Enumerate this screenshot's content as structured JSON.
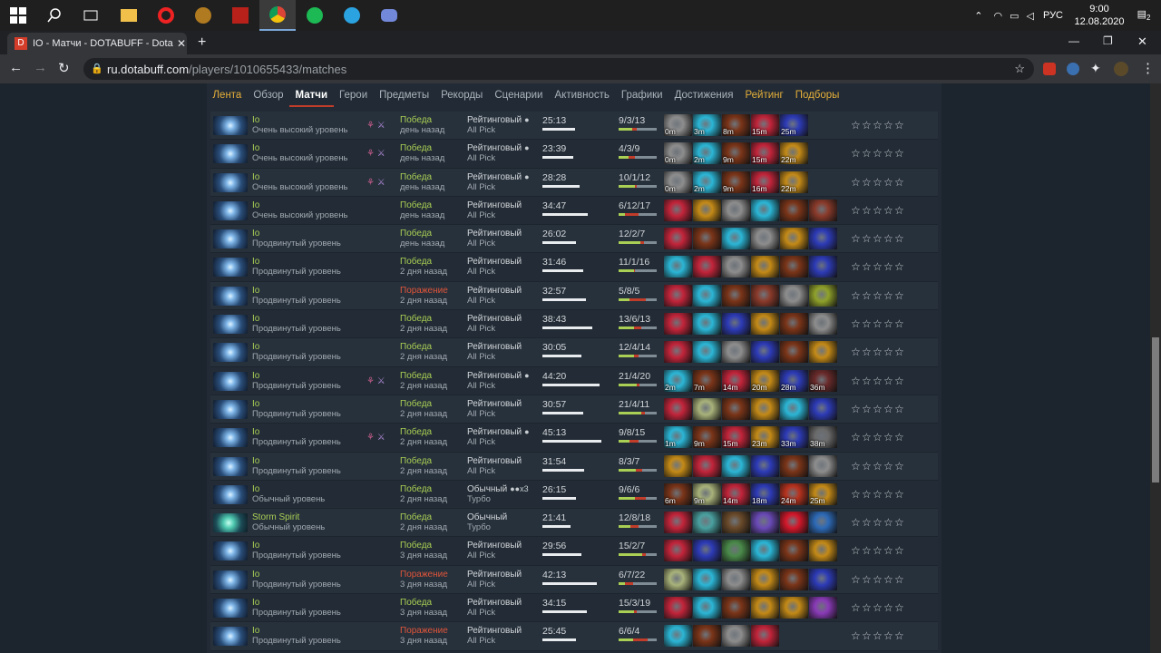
{
  "taskbar": {
    "language": "РУС",
    "time": "9:00",
    "date": "12.08.2020",
    "notifications": "2"
  },
  "browser": {
    "tab_title": "IO - Матчи - DOTABUFF - Dota 2",
    "url_host": "ru.dotabuff.com",
    "url_path": "/players/1010655433/matches"
  },
  "nav": [
    {
      "label": "Лента",
      "style": "gold"
    },
    {
      "label": "Обзор",
      "style": ""
    },
    {
      "label": "Матчи",
      "style": "active"
    },
    {
      "label": "Герои",
      "style": ""
    },
    {
      "label": "Предметы",
      "style": ""
    },
    {
      "label": "Рекорды",
      "style": ""
    },
    {
      "label": "Сценарии",
      "style": ""
    },
    {
      "label": "Активность",
      "style": ""
    },
    {
      "label": "Графики",
      "style": ""
    },
    {
      "label": "Достижения",
      "style": ""
    },
    {
      "label": "Рейтинг",
      "style": "gold"
    },
    {
      "label": "Подборы",
      "style": "gold"
    }
  ],
  "matches": [
    {
      "hero": "Io",
      "skill": "Очень высокий уровень",
      "party": true,
      "result": "Победа",
      "win": true,
      "ago": "день назад",
      "type": "Рейтинговый",
      "party_icon": "person-icon",
      "party_text": "",
      "mode": "All Pick",
      "duration": "25:13",
      "duration_fraction": 0.5,
      "kda": "9/3/13",
      "k": 9,
      "d": 3,
      "a": 13,
      "items": [
        {
          "c": "#8d8d8d",
          "t": "0m"
        },
        {
          "c": "#2bb6d6",
          "t": "3m"
        },
        {
          "c": "#7a3418",
          "t": "8m"
        },
        {
          "c": "#c2243a",
          "t": "15m"
        },
        {
          "c": "#2d3bb7",
          "t": "25m"
        }
      ]
    },
    {
      "hero": "Io",
      "skill": "Очень высокий уровень",
      "party": true,
      "result": "Победа",
      "win": true,
      "ago": "день назад",
      "type": "Рейтинговый",
      "party_icon": "person-icon",
      "party_text": "",
      "mode": "All Pick",
      "duration": "23:39",
      "duration_fraction": 0.47,
      "kda": "4/3/9",
      "k": 4,
      "d": 3,
      "a": 9,
      "items": [
        {
          "c": "#8d8d8d",
          "t": "0m"
        },
        {
          "c": "#2bb6d6",
          "t": "2m"
        },
        {
          "c": "#7a3418",
          "t": "9m"
        },
        {
          "c": "#c2243a",
          "t": "15m"
        },
        {
          "c": "#c48a17",
          "t": "22m"
        }
      ]
    },
    {
      "hero": "Io",
      "skill": "Очень высокий уровень",
      "party": true,
      "result": "Победа",
      "win": true,
      "ago": "день назад",
      "type": "Рейтинговый",
      "party_icon": "person-icon",
      "party_text": "",
      "mode": "All Pick",
      "duration": "28:28",
      "duration_fraction": 0.57,
      "kda": "10/1/12",
      "k": 10,
      "d": 1,
      "a": 12,
      "items": [
        {
          "c": "#8d8d8d",
          "t": "0m"
        },
        {
          "c": "#2bb6d6",
          "t": "2m"
        },
        {
          "c": "#7a3418",
          "t": "9m"
        },
        {
          "c": "#c2243a",
          "t": "16m"
        },
        {
          "c": "#c48a17",
          "t": "22m"
        }
      ]
    },
    {
      "hero": "Io",
      "skill": "Очень высокий уровень",
      "party": false,
      "result": "Победа",
      "win": true,
      "ago": "день назад",
      "type": "Рейтинговый",
      "party_icon": "",
      "party_text": "",
      "mode": "All Pick",
      "duration": "34:47",
      "duration_fraction": 0.7,
      "kda": "6/12/17",
      "k": 6,
      "d": 12,
      "a": 17,
      "items": [
        {
          "c": "#c2243a",
          "t": ""
        },
        {
          "c": "#c48a17",
          "t": ""
        },
        {
          "c": "#8d8d8d",
          "t": ""
        },
        {
          "c": "#2bb6d6",
          "t": ""
        },
        {
          "c": "#7a3418",
          "t": ""
        },
        {
          "c": "#8a3a2a",
          "t": ""
        }
      ]
    },
    {
      "hero": "Io",
      "skill": "Продвинутый уровень",
      "party": false,
      "result": "Победа",
      "win": true,
      "ago": "день назад",
      "type": "Рейтинговый",
      "party_icon": "",
      "party_text": "",
      "mode": "All Pick",
      "duration": "26:02",
      "duration_fraction": 0.52,
      "kda": "12/2/7",
      "k": 12,
      "d": 2,
      "a": 7,
      "items": [
        {
          "c": "#c2243a",
          "t": ""
        },
        {
          "c": "#7a3418",
          "t": ""
        },
        {
          "c": "#2bb6d6",
          "t": ""
        },
        {
          "c": "#8d8d8d",
          "t": ""
        },
        {
          "c": "#c48a17",
          "t": ""
        },
        {
          "c": "#2d3bb7",
          "t": ""
        }
      ]
    },
    {
      "hero": "Io",
      "skill": "Продвинутый уровень",
      "party": false,
      "result": "Победа",
      "win": true,
      "ago": "2 дня назад",
      "type": "Рейтинговый",
      "party_icon": "",
      "party_text": "",
      "mode": "All Pick",
      "duration": "31:46",
      "duration_fraction": 0.63,
      "kda": "11/1/16",
      "k": 11,
      "d": 1,
      "a": 16,
      "items": [
        {
          "c": "#2bb6d6",
          "t": ""
        },
        {
          "c": "#c2243a",
          "t": ""
        },
        {
          "c": "#8d8d8d",
          "t": ""
        },
        {
          "c": "#c48a17",
          "t": ""
        },
        {
          "c": "#7a3418",
          "t": ""
        },
        {
          "c": "#2d3bb7",
          "t": ""
        }
      ]
    },
    {
      "hero": "Io",
      "skill": "Продвинутый уровень",
      "party": false,
      "result": "Поражение",
      "win": false,
      "ago": "2 дня назад",
      "type": "Рейтинговый",
      "party_icon": "",
      "party_text": "",
      "mode": "All Pick",
      "duration": "32:57",
      "duration_fraction": 0.66,
      "kda": "5/8/5",
      "k": 5,
      "d": 8,
      "a": 5,
      "items": [
        {
          "c": "#c2243a",
          "t": ""
        },
        {
          "c": "#2bb6d6",
          "t": ""
        },
        {
          "c": "#7a3418",
          "t": ""
        },
        {
          "c": "#8a3a2a",
          "t": ""
        },
        {
          "c": "#8d8d8d",
          "t": ""
        },
        {
          "c": "#8fa12a",
          "t": ""
        }
      ]
    },
    {
      "hero": "Io",
      "skill": "Продвинутый уровень",
      "party": false,
      "result": "Победа",
      "win": true,
      "ago": "2 дня назад",
      "type": "Рейтинговый",
      "party_icon": "",
      "party_text": "",
      "mode": "All Pick",
      "duration": "38:43",
      "duration_fraction": 0.77,
      "kda": "13/6/13",
      "k": 13,
      "d": 6,
      "a": 13,
      "items": [
        {
          "c": "#c2243a",
          "t": ""
        },
        {
          "c": "#2bb6d6",
          "t": ""
        },
        {
          "c": "#2d3bb7",
          "t": ""
        },
        {
          "c": "#c48a17",
          "t": ""
        },
        {
          "c": "#7a3418",
          "t": ""
        },
        {
          "c": "#8d8d8d",
          "t": ""
        }
      ]
    },
    {
      "hero": "Io",
      "skill": "Продвинутый уровень",
      "party": false,
      "result": "Победа",
      "win": true,
      "ago": "2 дня назад",
      "type": "Рейтинговый",
      "party_icon": "",
      "party_text": "",
      "mode": "All Pick",
      "duration": "30:05",
      "duration_fraction": 0.6,
      "kda": "12/4/14",
      "k": 12,
      "d": 4,
      "a": 14,
      "items": [
        {
          "c": "#c2243a",
          "t": ""
        },
        {
          "c": "#2bb6d6",
          "t": ""
        },
        {
          "c": "#8d8d8d",
          "t": ""
        },
        {
          "c": "#2d3bb7",
          "t": ""
        },
        {
          "c": "#7a3418",
          "t": ""
        },
        {
          "c": "#c48a17",
          "t": ""
        }
      ]
    },
    {
      "hero": "Io",
      "skill": "Продвинутый уровень",
      "party": true,
      "result": "Победа",
      "win": true,
      "ago": "2 дня назад",
      "type": "Рейтинговый",
      "party_icon": "person-icon",
      "party_text": "",
      "mode": "All Pick",
      "duration": "44:20",
      "duration_fraction": 0.88,
      "kda": "21/4/20",
      "k": 21,
      "d": 4,
      "a": 20,
      "items": [
        {
          "c": "#2bb6d6",
          "t": "2m"
        },
        {
          "c": "#7a3418",
          "t": "7m"
        },
        {
          "c": "#c2243a",
          "t": "14m"
        },
        {
          "c": "#c48a17",
          "t": "20m"
        },
        {
          "c": "#2d3bb7",
          "t": "28m"
        },
        {
          "c": "#6a2a2a",
          "t": "36m"
        }
      ]
    },
    {
      "hero": "Io",
      "skill": "Продвинутый уровень",
      "party": false,
      "result": "Победа",
      "win": true,
      "ago": "2 дня назад",
      "type": "Рейтинговый",
      "party_icon": "",
      "party_text": "",
      "mode": "All Pick",
      "duration": "30:57",
      "duration_fraction": 0.62,
      "kda": "21/4/11",
      "k": 21,
      "d": 4,
      "a": 11,
      "items": [
        {
          "c": "#c2243a",
          "t": ""
        },
        {
          "c": "#a8b27a",
          "t": ""
        },
        {
          "c": "#7a3418",
          "t": ""
        },
        {
          "c": "#c48a17",
          "t": ""
        },
        {
          "c": "#2bb6d6",
          "t": ""
        },
        {
          "c": "#2d3bb7",
          "t": ""
        }
      ]
    },
    {
      "hero": "Io",
      "skill": "Продвинутый уровень",
      "party": true,
      "result": "Победа",
      "win": true,
      "ago": "2 дня назад",
      "type": "Рейтинговый",
      "party_icon": "person-icon",
      "party_text": "",
      "mode": "All Pick",
      "duration": "45:13",
      "duration_fraction": 0.9,
      "kda": "9/8/15",
      "k": 9,
      "d": 8,
      "a": 15,
      "items": [
        {
          "c": "#2bb6d6",
          "t": "1m"
        },
        {
          "c": "#7a3418",
          "t": "9m"
        },
        {
          "c": "#c2243a",
          "t": "15m"
        },
        {
          "c": "#c48a17",
          "t": "23m"
        },
        {
          "c": "#2d3bb7",
          "t": "33m"
        },
        {
          "c": "#6a6a6a",
          "t": "38m"
        }
      ]
    },
    {
      "hero": "Io",
      "skill": "Продвинутый уровень",
      "party": false,
      "result": "Победа",
      "win": true,
      "ago": "2 дня назад",
      "type": "Рейтинговый",
      "party_icon": "",
      "party_text": "",
      "mode": "All Pick",
      "duration": "31:54",
      "duration_fraction": 0.64,
      "kda": "8/3/7",
      "k": 8,
      "d": 3,
      "a": 7,
      "items": [
        {
          "c": "#c48a17",
          "t": ""
        },
        {
          "c": "#c2243a",
          "t": ""
        },
        {
          "c": "#2bb6d6",
          "t": ""
        },
        {
          "c": "#2d3bb7",
          "t": ""
        },
        {
          "c": "#7a3418",
          "t": ""
        },
        {
          "c": "#8d8d8d",
          "t": ""
        }
      ]
    },
    {
      "hero": "Io",
      "skill": "Обычный уровень",
      "party": false,
      "result": "Победа",
      "win": true,
      "ago": "2 дня назад",
      "type": "Обычный",
      "party_icon": "group-icon",
      "party_text": "x3",
      "mode": "Турбо",
      "duration": "26:15",
      "duration_fraction": 0.52,
      "kda": "9/6/6",
      "k": 9,
      "d": 6,
      "a": 6,
      "items": [
        {
          "c": "#7a3418",
          "t": "6m"
        },
        {
          "c": "#a8b27a",
          "t": "9m"
        },
        {
          "c": "#c2243a",
          "t": "14m"
        },
        {
          "c": "#2d3bb7",
          "t": "18m"
        },
        {
          "c": "#b8321e",
          "t": "24m"
        },
        {
          "c": "#c48a17",
          "t": "25m"
        }
      ]
    },
    {
      "hero": "Storm Spirit",
      "skill": "Обычный уровень",
      "party": false,
      "result": "Победа",
      "win": true,
      "ago": "2 дня назад",
      "type": "Обычный",
      "party_icon": "",
      "party_text": "",
      "mode": "Турбо",
      "duration": "21:41",
      "duration_fraction": 0.43,
      "kda": "12/8/18",
      "k": 12,
      "d": 8,
      "a": 18,
      "items": [
        {
          "c": "#c2243a",
          "t": ""
        },
        {
          "c": "#4aa0a0",
          "t": ""
        },
        {
          "c": "#6a4a2a",
          "t": ""
        },
        {
          "c": "#6a4ab7",
          "t": ""
        },
        {
          "c": "#d3172a",
          "t": ""
        },
        {
          "c": "#2d6ab7",
          "t": ""
        }
      ]
    },
    {
      "hero": "Io",
      "skill": "Продвинутый уровень",
      "party": false,
      "result": "Победа",
      "win": true,
      "ago": "3 дня назад",
      "type": "Рейтинговый",
      "party_icon": "",
      "party_text": "",
      "mode": "All Pick",
      "duration": "29:56",
      "duration_fraction": 0.6,
      "kda": "15/2/7",
      "k": 15,
      "d": 2,
      "a": 7,
      "items": [
        {
          "c": "#c2243a",
          "t": ""
        },
        {
          "c": "#2d3bb7",
          "t": ""
        },
        {
          "c": "#4a8a4a",
          "t": ""
        },
        {
          "c": "#2bb6d6",
          "t": ""
        },
        {
          "c": "#7a3418",
          "t": ""
        },
        {
          "c": "#c48a17",
          "t": ""
        }
      ]
    },
    {
      "hero": "Io",
      "skill": "Продвинутый уровень",
      "party": false,
      "result": "Поражение",
      "win": false,
      "ago": "3 дня назад",
      "type": "Рейтинговый",
      "party_icon": "",
      "party_text": "",
      "mode": "All Pick",
      "duration": "42:13",
      "duration_fraction": 0.84,
      "kda": "6/7/22",
      "k": 6,
      "d": 7,
      "a": 22,
      "items": [
        {
          "c": "#a8b27a",
          "t": ""
        },
        {
          "c": "#2bb6d6",
          "t": ""
        },
        {
          "c": "#8d8d8d",
          "t": ""
        },
        {
          "c": "#c48a17",
          "t": ""
        },
        {
          "c": "#7a3418",
          "t": ""
        },
        {
          "c": "#2d3bb7",
          "t": ""
        }
      ]
    },
    {
      "hero": "Io",
      "skill": "Продвинутый уровень",
      "party": false,
      "result": "Победа",
      "win": true,
      "ago": "3 дня назад",
      "type": "Рейтинговый",
      "party_icon": "",
      "party_text": "",
      "mode": "All Pick",
      "duration": "34:15",
      "duration_fraction": 0.68,
      "kda": "15/3/19",
      "k": 15,
      "d": 3,
      "a": 19,
      "items": [
        {
          "c": "#c2243a",
          "t": ""
        },
        {
          "c": "#2bb6d6",
          "t": ""
        },
        {
          "c": "#7a3418",
          "t": ""
        },
        {
          "c": "#c48a17",
          "t": ""
        },
        {
          "c": "#c48a17",
          "t": ""
        },
        {
          "c": "#8a3ab7",
          "t": ""
        }
      ]
    },
    {
      "hero": "Io",
      "skill": "Продвинутый уровень",
      "party": false,
      "result": "Поражение",
      "win": false,
      "ago": "3 дня назад",
      "type": "Рейтинговый",
      "party_icon": "",
      "party_text": "",
      "mode": "All Pick",
      "duration": "25:45",
      "duration_fraction": 0.51,
      "kda": "6/6/4",
      "k": 6,
      "d": 6,
      "a": 4,
      "items": [
        {
          "c": "#2bb6d6",
          "t": ""
        },
        {
          "c": "#7a3418",
          "t": ""
        },
        {
          "c": "#8d8d8d",
          "t": ""
        },
        {
          "c": "#c2243a",
          "t": ""
        }
      ]
    }
  ]
}
